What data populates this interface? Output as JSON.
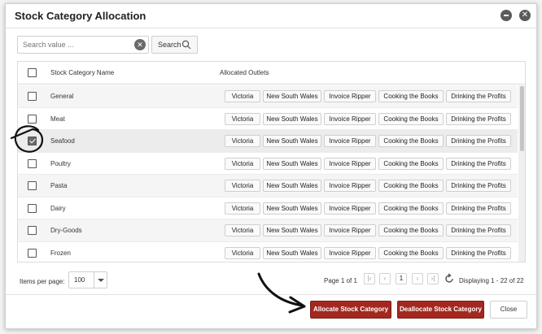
{
  "dialog": {
    "title": "Stock Category Allocation"
  },
  "search": {
    "placeholder": "Search value ...",
    "value": "",
    "button_label": "Search"
  },
  "grid": {
    "col_name": "Stock Category Name",
    "col_outlets": "Allocated Outlets",
    "outlets": [
      "Victoria",
      "New South Wales",
      "Invoice Ripper",
      "Cooking the Books",
      "Drinking the Profits"
    ],
    "rows": [
      {
        "name": "General",
        "checked": false
      },
      {
        "name": "Meat",
        "checked": false
      },
      {
        "name": "Seafood",
        "checked": true
      },
      {
        "name": "Poultry",
        "checked": false
      },
      {
        "name": "Pasta",
        "checked": false
      },
      {
        "name": "Dairy",
        "checked": false
      },
      {
        "name": "Dry-Goods",
        "checked": false
      },
      {
        "name": "Frozen",
        "checked": false
      }
    ]
  },
  "pager": {
    "items_per_page_label": "Items per page:",
    "page_size": "100",
    "page_info": "Page 1 of 1",
    "current_page": "1",
    "displaying": "Displaying 1 - 22 of 22"
  },
  "footer": {
    "allocate_label": "Allocate Stock Category",
    "deallocate_label": "Deallocate Stock Category",
    "close_label": "Close"
  },
  "colors": {
    "primary_button": "#a3281f",
    "annotation_ink": "#111111"
  }
}
